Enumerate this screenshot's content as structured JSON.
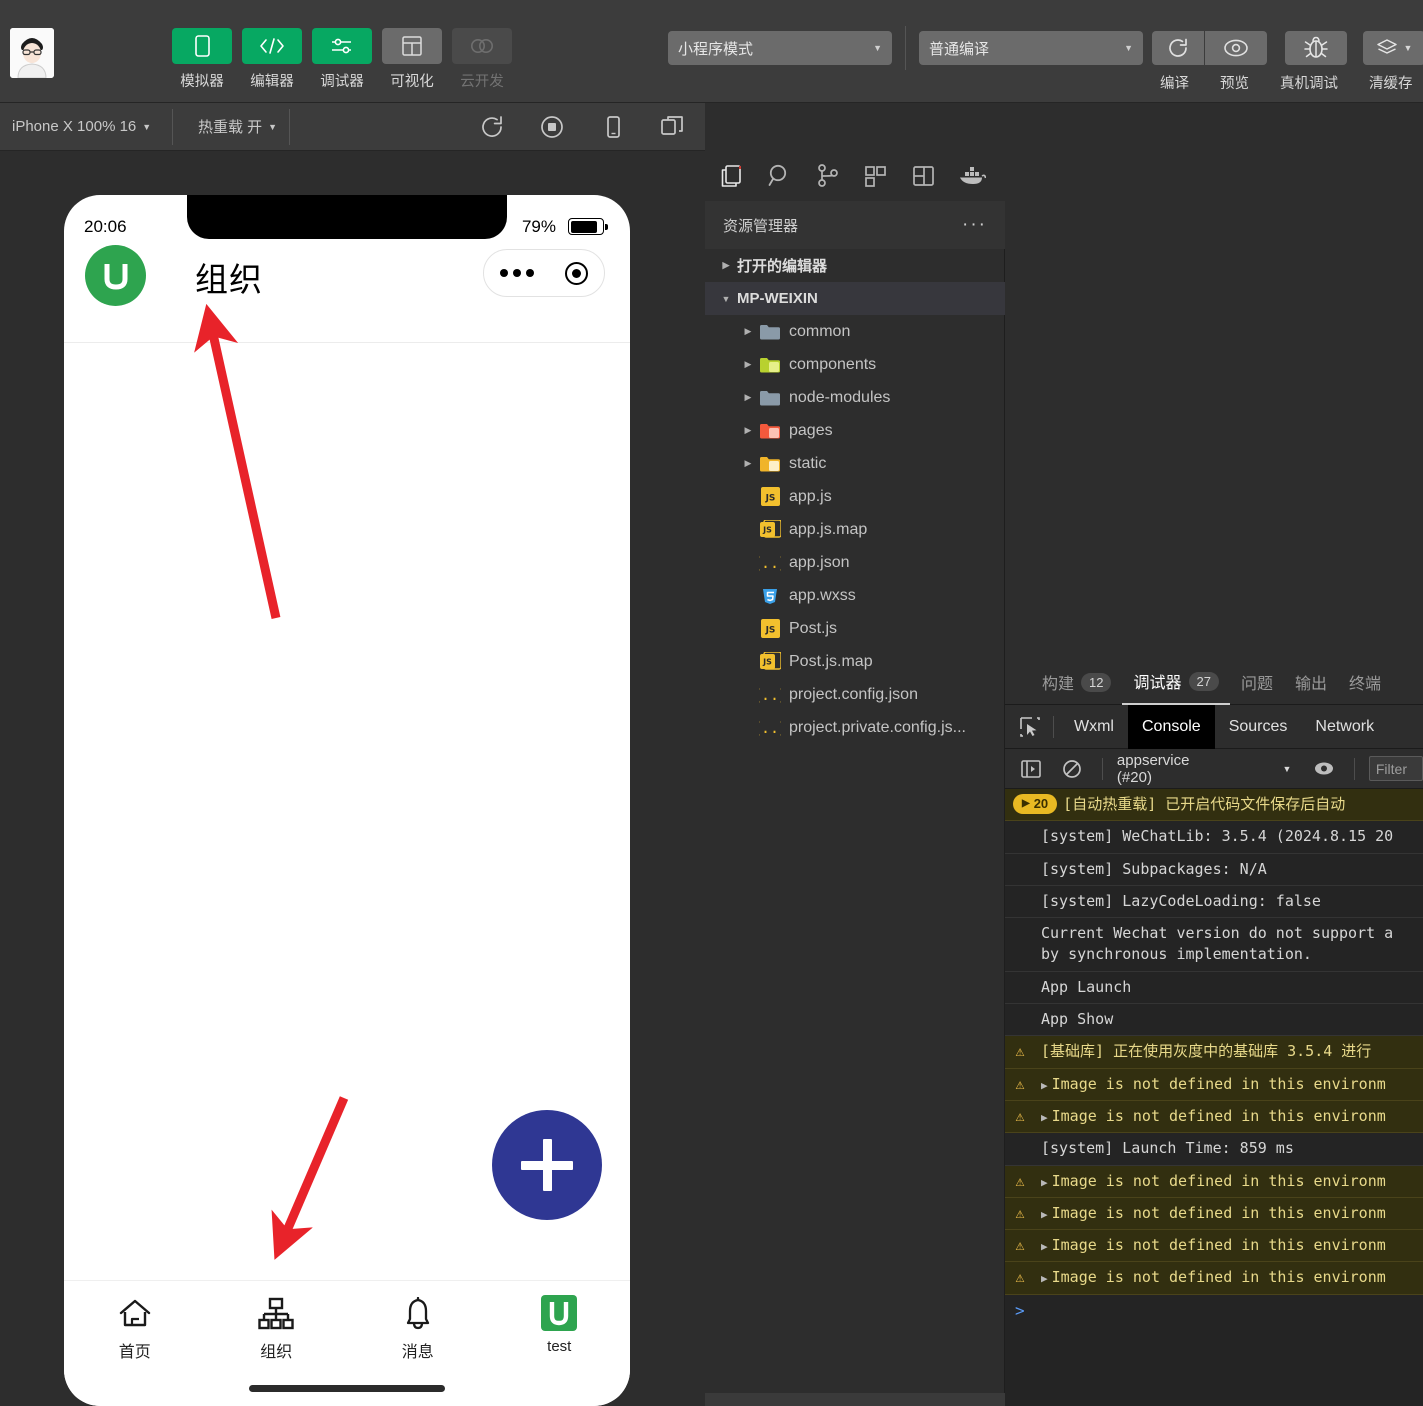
{
  "toolbar": {
    "tools": [
      {
        "label": "模拟器",
        "icon": "phone-icon",
        "style": "green"
      },
      {
        "label": "编辑器",
        "icon": "code-icon",
        "style": "green"
      },
      {
        "label": "调试器",
        "icon": "debugger-icon",
        "style": "green"
      },
      {
        "label": "可视化",
        "icon": "layout-icon",
        "style": "grey"
      },
      {
        "label": "云开发",
        "icon": "cloud-icon",
        "style": "dim"
      }
    ],
    "mode_select": "小程序模式",
    "compile_select": "普通编译",
    "actions": [
      {
        "label": "编译",
        "icon": "refresh-icon"
      },
      {
        "label": "预览",
        "icon": "eye-icon"
      },
      {
        "label": "真机调试",
        "icon": "bug-icon"
      },
      {
        "label": "清缓存",
        "icon": "layers-icon"
      }
    ]
  },
  "subbar": {
    "device": "iPhone X 100% 16",
    "hotreload": "热重载 开",
    "icons": [
      "refresh-icon",
      "record-icon",
      "device-icon",
      "windows-icon"
    ]
  },
  "simulator": {
    "status": {
      "time": "20:06",
      "battery": "79%"
    },
    "nav": {
      "title": "组织",
      "logo_letter": "U",
      "logo_color": "#2ea44f"
    },
    "fab": {
      "icon": "plus-icon",
      "color": "#2f3793"
    },
    "tabs": [
      {
        "label": "首页",
        "icon": "home-icon",
        "active": false
      },
      {
        "label": "组织",
        "icon": "sitemap-icon",
        "active": true
      },
      {
        "label": "消息",
        "icon": "bell-icon",
        "active": false
      },
      {
        "label": "test",
        "icon": "u-logo-icon",
        "active": false
      }
    ]
  },
  "explorer": {
    "activity_icons": [
      "files-icon",
      "search-icon",
      "source-control-icon",
      "extensions-icon",
      "splitview-icon",
      "docker-icon"
    ],
    "title": "资源管理器",
    "more": "···",
    "tree": [
      {
        "label": "打开的编辑器",
        "type": "section",
        "expanded": false,
        "indent": 0
      },
      {
        "label": "MP-WEIXIN",
        "type": "section",
        "expanded": true,
        "indent": 0,
        "selected": true
      },
      {
        "label": "common",
        "type": "folder",
        "expanded": false,
        "indent": 1,
        "color": "#8a9aa8"
      },
      {
        "label": "components",
        "type": "folder",
        "expanded": false,
        "indent": 1,
        "color": "#b8d12f"
      },
      {
        "label": "node-modules",
        "type": "folder",
        "expanded": false,
        "indent": 1,
        "color": "#8a9aa8"
      },
      {
        "label": "pages",
        "type": "folder",
        "expanded": false,
        "indent": 1,
        "color": "#f4593c"
      },
      {
        "label": "static",
        "type": "folder",
        "expanded": false,
        "indent": 1,
        "color": "#f0b429"
      },
      {
        "label": "app.js",
        "type": "js",
        "indent": 1
      },
      {
        "label": "app.js.map",
        "type": "jsmap",
        "indent": 1
      },
      {
        "label": "app.json",
        "type": "json",
        "indent": 1
      },
      {
        "label": "app.wxss",
        "type": "css",
        "indent": 1
      },
      {
        "label": "Post.js",
        "type": "js",
        "indent": 1
      },
      {
        "label": "Post.js.map",
        "type": "jsmap",
        "indent": 1
      },
      {
        "label": "project.config.json",
        "type": "json",
        "indent": 1
      },
      {
        "label": "project.private.config.js...",
        "type": "json",
        "indent": 1
      }
    ]
  },
  "console": {
    "panel_tabs": [
      {
        "label": "构建",
        "badge": "12",
        "active": false
      },
      {
        "label": "调试器",
        "badge": "27",
        "active": true
      },
      {
        "label": "问题",
        "badge": "",
        "active": false
      },
      {
        "label": "输出",
        "badge": "",
        "active": false
      },
      {
        "label": "终端",
        "badge": "",
        "active": false
      }
    ],
    "devtool_tabs": [
      {
        "label": "Wxml",
        "active": false
      },
      {
        "label": "Console",
        "active": true
      },
      {
        "label": "Sources",
        "active": false
      },
      {
        "label": "Network",
        "active": false
      }
    ],
    "context": "appservice (#20)",
    "filter_placeholder": "Filter",
    "hot_badge_count": "20",
    "logs": [
      {
        "level": "hot",
        "badge": "20",
        "text": "[自动热重载] 已开启代码文件保存后自动",
        "expandable": false
      },
      {
        "level": "info",
        "text": "[system] WeChatLib: 3.5.4 (2024.8.15 20",
        "expandable": false
      },
      {
        "level": "info",
        "text": "[system] Subpackages: N/A",
        "expandable": false
      },
      {
        "level": "info",
        "text": "[system] LazyCodeLoading: false",
        "expandable": false
      },
      {
        "level": "info",
        "text": "Current Wechat version do not support a",
        "text2": "by synchronous implementation.",
        "expandable": false
      },
      {
        "level": "info",
        "text": "App Launch",
        "expandable": false
      },
      {
        "level": "info",
        "text": "App Show",
        "expandable": false
      },
      {
        "level": "warn",
        "text": "[基础库] 正在使用灰度中的基础库 3.5.4 进行",
        "expandable": false
      },
      {
        "level": "warn",
        "text": "Image is not defined in this environm",
        "expandable": true
      },
      {
        "level": "warn",
        "text": "Image is not defined in this environm",
        "expandable": true
      },
      {
        "level": "info",
        "text": "[system] Launch Time: 859 ms",
        "expandable": false
      },
      {
        "level": "warn",
        "text": "Image is not defined in this environm",
        "expandable": true
      },
      {
        "level": "warn",
        "text": "Image is not defined in this environm",
        "expandable": true
      },
      {
        "level": "warn",
        "text": "Image is not defined in this environm",
        "expandable": true
      },
      {
        "level": "warn",
        "text": "Image is not defined in this environm",
        "expandable": true
      }
    ],
    "prompt": ">"
  }
}
